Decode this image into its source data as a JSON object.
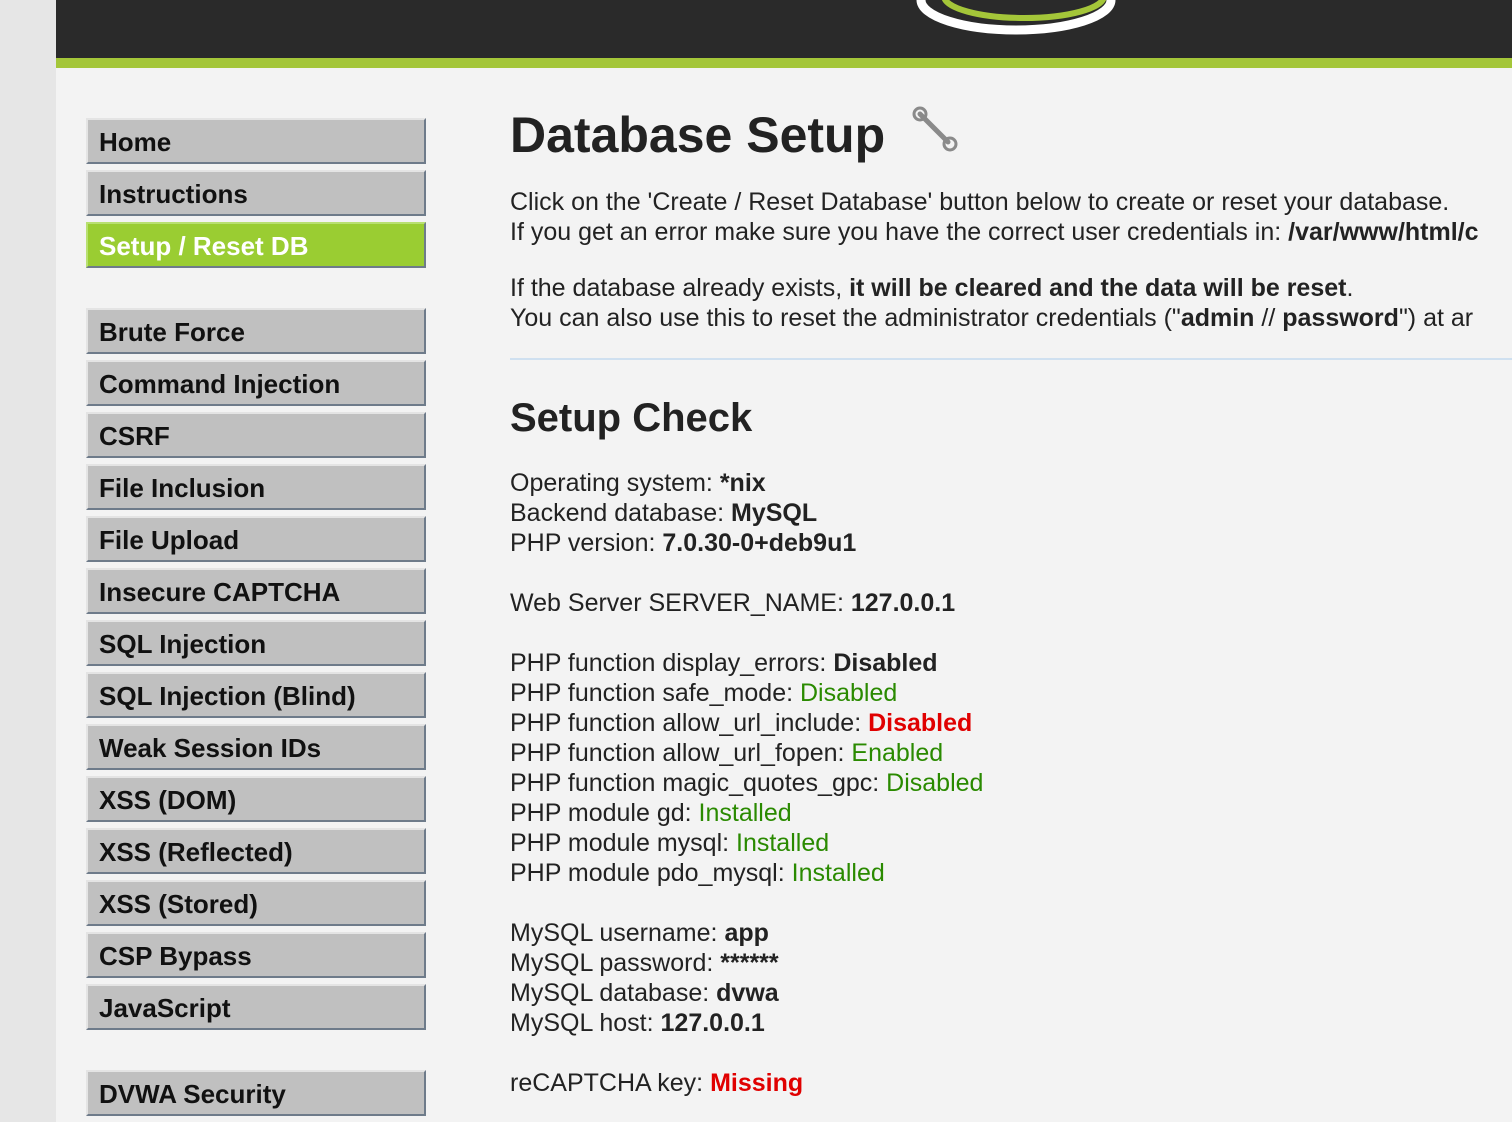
{
  "menu": {
    "group1": [
      "Home",
      "Instructions",
      "Setup / Reset DB"
    ],
    "group2": [
      "Brute Force",
      "Command Injection",
      "CSRF",
      "File Inclusion",
      "File Upload",
      "Insecure CAPTCHA",
      "SQL Injection",
      "SQL Injection (Blind)",
      "Weak Session IDs",
      "XSS (DOM)",
      "XSS (Reflected)",
      "XSS (Stored)",
      "CSP Bypass",
      "JavaScript"
    ],
    "group3": [
      "DVWA Security"
    ]
  },
  "main": {
    "title": "Database Setup",
    "intro1": "Click on the 'Create / Reset Database' button below to create or reset your database.",
    "intro2_prefix": "If you get an error make sure you have the correct user credentials in: ",
    "intro2_path": "/var/www/html/c",
    "intro3_prefix": "If the database already exists, ",
    "intro3_bold": "it will be cleared and the data will be reset",
    "intro3_suffix": ".",
    "intro4_prefix": "You can also use this to reset the administrator credentials (\"",
    "intro4_user": "admin",
    "intro4_sep": " // ",
    "intro4_pass": "password",
    "intro4_suffix": "\") at ar",
    "setup_check_title": "Setup Check"
  },
  "check": {
    "os_label": "Operating system: ",
    "os_value": "*nix",
    "backend_label": "Backend database: ",
    "backend_value": "MySQL",
    "php_label": "PHP version: ",
    "php_value": "7.0.30-0+deb9u1",
    "server_label": "Web Server SERVER_NAME: ",
    "server_value": "127.0.0.1",
    "display_errors_label": "PHP function display_errors: ",
    "display_errors_value": "Disabled",
    "safe_mode_label": "PHP function safe_mode: ",
    "safe_mode_value": "Disabled",
    "allow_url_include_label": "PHP function allow_url_include: ",
    "allow_url_include_value": "Disabled",
    "allow_url_fopen_label": "PHP function allow_url_fopen: ",
    "allow_url_fopen_value": "Enabled",
    "magic_quotes_label": "PHP function magic_quotes_gpc: ",
    "magic_quotes_value": "Disabled",
    "gd_label": "PHP module gd: ",
    "gd_value": "Installed",
    "mysql_label": "PHP module mysql: ",
    "mysql_value": "Installed",
    "pdo_label": "PHP module pdo_mysql: ",
    "pdo_value": "Installed",
    "db_user_label": "MySQL username: ",
    "db_user_value": "app",
    "db_pass_label": "MySQL password: ",
    "db_pass_value": "******",
    "db_name_label": "MySQL database: ",
    "db_name_value": "dvwa",
    "db_host_label": "MySQL host: ",
    "db_host_value": "127.0.0.1",
    "recaptcha_label": "reCAPTCHA key: ",
    "recaptcha_value": "Missing"
  },
  "colors": {
    "accent_green": "#9acd32",
    "ok_green": "#2a8a00",
    "error_red": "#e00000",
    "header_dark": "#2a2a2a"
  }
}
